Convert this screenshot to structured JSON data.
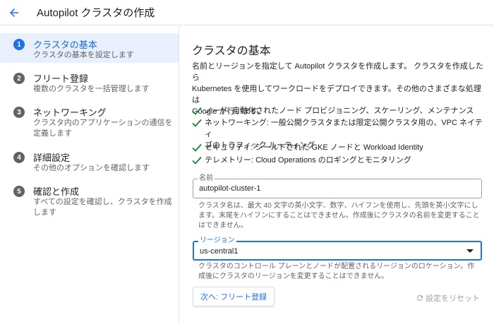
{
  "header": {
    "title": "Autopilot クラスタの作成",
    "back_icon": "arrow-back-icon"
  },
  "sidebar": {
    "steps": [
      {
        "num": "1",
        "title": "クラスタの基本",
        "desc": "クラスタの基本を設定します"
      },
      {
        "num": "2",
        "title": "フリート登録",
        "desc": "複数のクラスタを一括管理します"
      },
      {
        "num": "3",
        "title": "ネットワーキング",
        "desc_line1": "クラスタ内のアプリケーションの通信を",
        "desc_line2": "定義します"
      },
      {
        "num": "4",
        "title": "詳細設定",
        "desc": "その他のオプションを確認します"
      },
      {
        "num": "5",
        "title": "確認と作成",
        "desc_line1": "すべての設定を確認し、クラスタを作成",
        "desc_line2": "します"
      }
    ]
  },
  "main": {
    "title": "クラスタの基本",
    "intro_line1": "名前とリージョンを指定して Autopilot クラスタを作成します。 クラスタを作成したら",
    "intro_line2": "Kubernetes を使用してワークロードをデプロイできます。その他のさまざまな処理は",
    "intro_line3": "Google が行います。",
    "features": [
      {
        "text": "ノード: 自動化されたノード プロビジョニング、スケーリング、メンテナンス"
      },
      {
        "line1": "ネットワーキング: 一般公開クラスタまたは限定公開クラスタ用の、VPC ネイティ",
        "line2": "ブのトラフィック ルーティング"
      },
      {
        "text": "セキュリティ: シールドされた GKE ノードと Workload Identity"
      },
      {
        "text": "テレメトリー: Cloud Operations のロギングとモニタリング"
      }
    ],
    "name_field": {
      "label": "名前",
      "value": "autopilot-cluster-1",
      "hint_line1": "クラスタ名は、最大 40 文字の英小文字、数字、ハイフンを使用し、先頭を英小文字にし",
      "hint_line2": "ます。末尾をハイフンにすることはできません。作成後にクラスタの名前を変更すること",
      "hint_line3": "はできません。"
    },
    "region_field": {
      "label": "リージョン",
      "value": "us-central1",
      "hint_line1": "クラスタのコントロール プレーンとノードが配置されるリージョンのロケーション。作",
      "hint_line2": "成後にクラスタのリージョンを変更することはできません。"
    },
    "next_button": "次へ: フリート登録",
    "reset_button": "設定をリセット"
  },
  "colors": {
    "accent": "#1a73e8",
    "active_bg": "#e8f0fe",
    "check": "#188038"
  }
}
